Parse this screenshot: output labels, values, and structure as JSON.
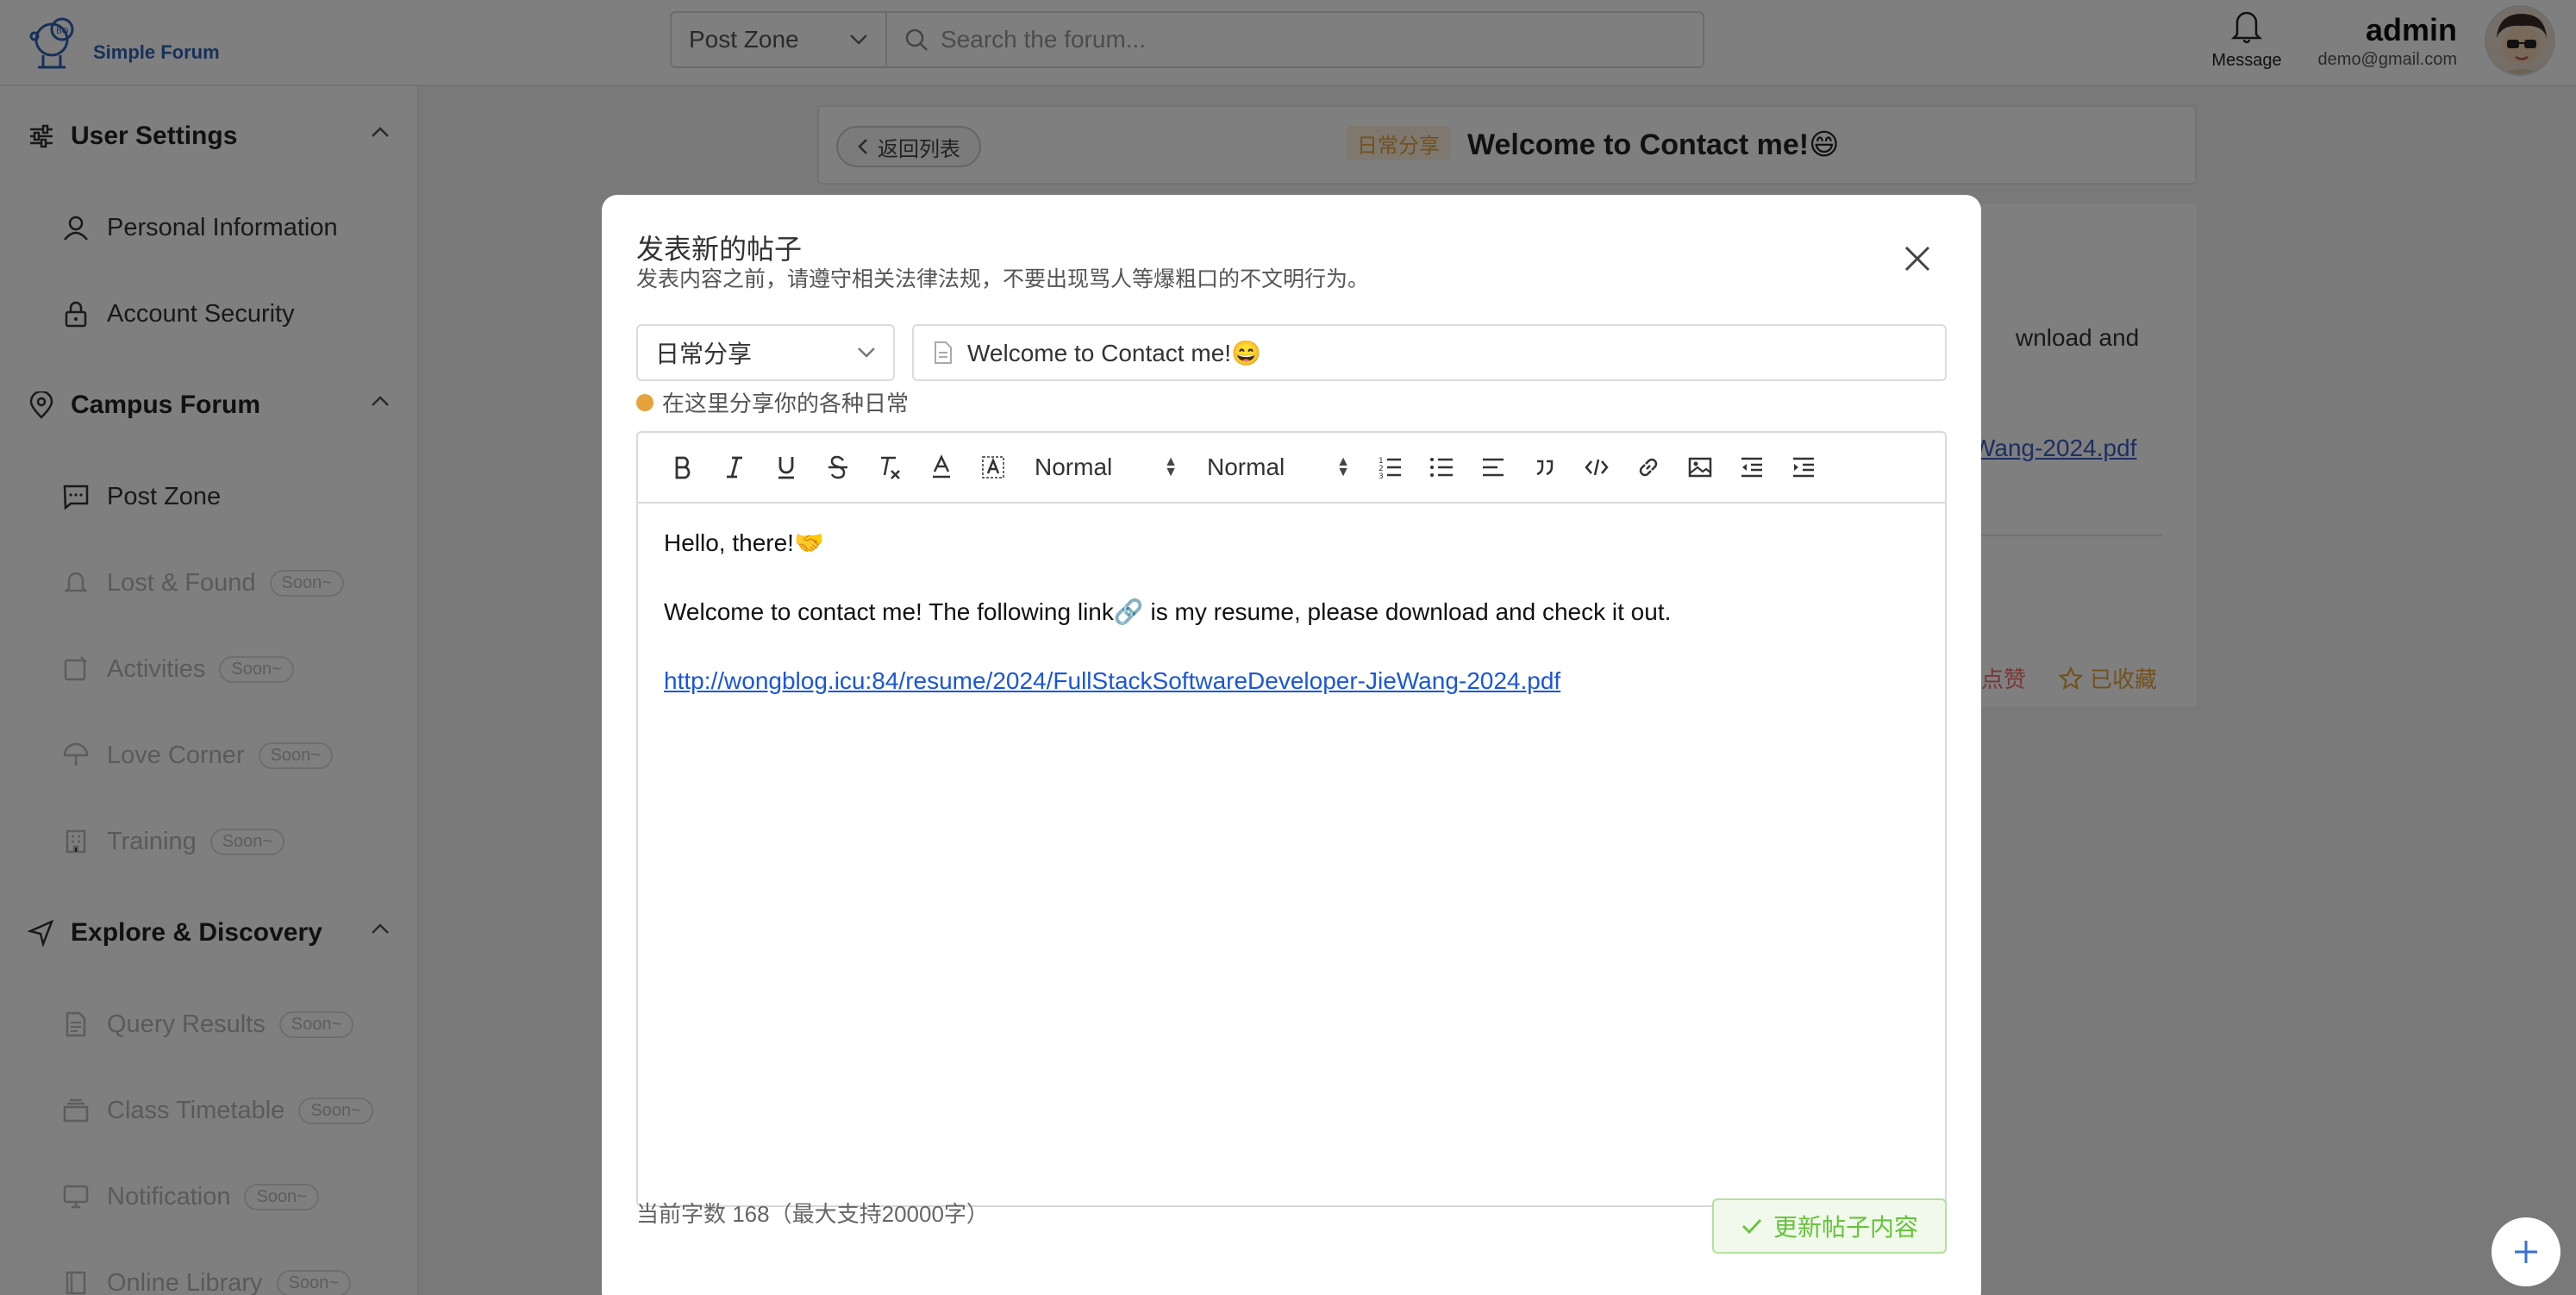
{
  "app": {
    "logo_text": "Simple Forum"
  },
  "topbar": {
    "zone_select": "Post Zone",
    "search_placeholder": "Search the forum...",
    "message_label": "Message",
    "user_name": "admin",
    "user_email": "demo@gmail.com"
  },
  "sidebar": {
    "sections": [
      {
        "title": "User Settings",
        "icon": "sliders-icon",
        "items": [
          {
            "label": "Personal Information",
            "icon": "user-icon",
            "enabled": true
          },
          {
            "label": "Account Security",
            "icon": "lock-icon",
            "enabled": true
          }
        ]
      },
      {
        "title": "Campus Forum",
        "icon": "location-pin-icon",
        "items": [
          {
            "label": "Post Zone",
            "icon": "chat-icon",
            "enabled": true
          },
          {
            "label": "Lost & Found",
            "icon": "bell-icon",
            "enabled": false,
            "badge": "Soon~"
          },
          {
            "label": "Activities",
            "icon": "calendar-icon",
            "enabled": false,
            "badge": "Soon~"
          },
          {
            "label": "Love Corner",
            "icon": "umbrella-icon",
            "enabled": false,
            "badge": "Soon~"
          },
          {
            "label": "Training",
            "icon": "building-icon",
            "enabled": false,
            "badge": "Soon~"
          }
        ]
      },
      {
        "title": "Explore & Discovery",
        "icon": "navigation-icon",
        "items": [
          {
            "label": "Query Results",
            "icon": "document-icon",
            "enabled": false,
            "badge": "Soon~"
          },
          {
            "label": "Class Timetable",
            "icon": "stack-icon",
            "enabled": false,
            "badge": "Soon~"
          },
          {
            "label": "Notification",
            "icon": "monitor-icon",
            "enabled": false,
            "badge": "Soon~"
          },
          {
            "label": "Online Library",
            "icon": "book-icon",
            "enabled": false,
            "badge": "Soon~"
          }
        ]
      }
    ]
  },
  "post": {
    "back_label": "返回列表",
    "tag": "日常分享",
    "title": "Welcome to Contact me!😄",
    "body_text_fragment": "wnload and",
    "body_link_fragment": "Wang-2024.pdf",
    "like_fragment": "点赞",
    "favorite_label": "已收藏"
  },
  "modal": {
    "title": "发表新的帖子",
    "subtitle": "发表内容之前，请遵守相关法律法规，不要出现骂人等爆粗口的不文明行为。",
    "category": "日常分享",
    "post_title": "Welcome to Contact me!😄",
    "category_hint": "在这里分享你的各种日常",
    "toolbar": {
      "header_select": "Normal",
      "size_select": "Normal",
      "buttons": [
        "bold-icon",
        "italic-icon",
        "underline-icon",
        "strike-icon",
        "clear-format-icon",
        "font-color-icon",
        "background-color-icon",
        "ordered-list-icon",
        "bullet-list-icon",
        "align-icon",
        "blockquote-icon",
        "code-icon",
        "link-icon",
        "image-icon",
        "outdent-icon",
        "indent-icon"
      ]
    },
    "content": {
      "line1": "Hello, there!🤝",
      "line2": "Welcome to contact me! The following link🔗 is my resume, please download and check it out.",
      "link": "http://wongblog.icu:84/resume/2024/FullStackSoftwareDeveloper-JieWang-2024.pdf"
    },
    "word_count": "当前字数 168（最大支持20000字）",
    "submit_label": "更新帖子内容"
  },
  "colors": {
    "accent": "#2f63b4",
    "tag_orange": "#e6a23c",
    "success_green": "#67c23a",
    "link_blue": "#1a56db"
  }
}
